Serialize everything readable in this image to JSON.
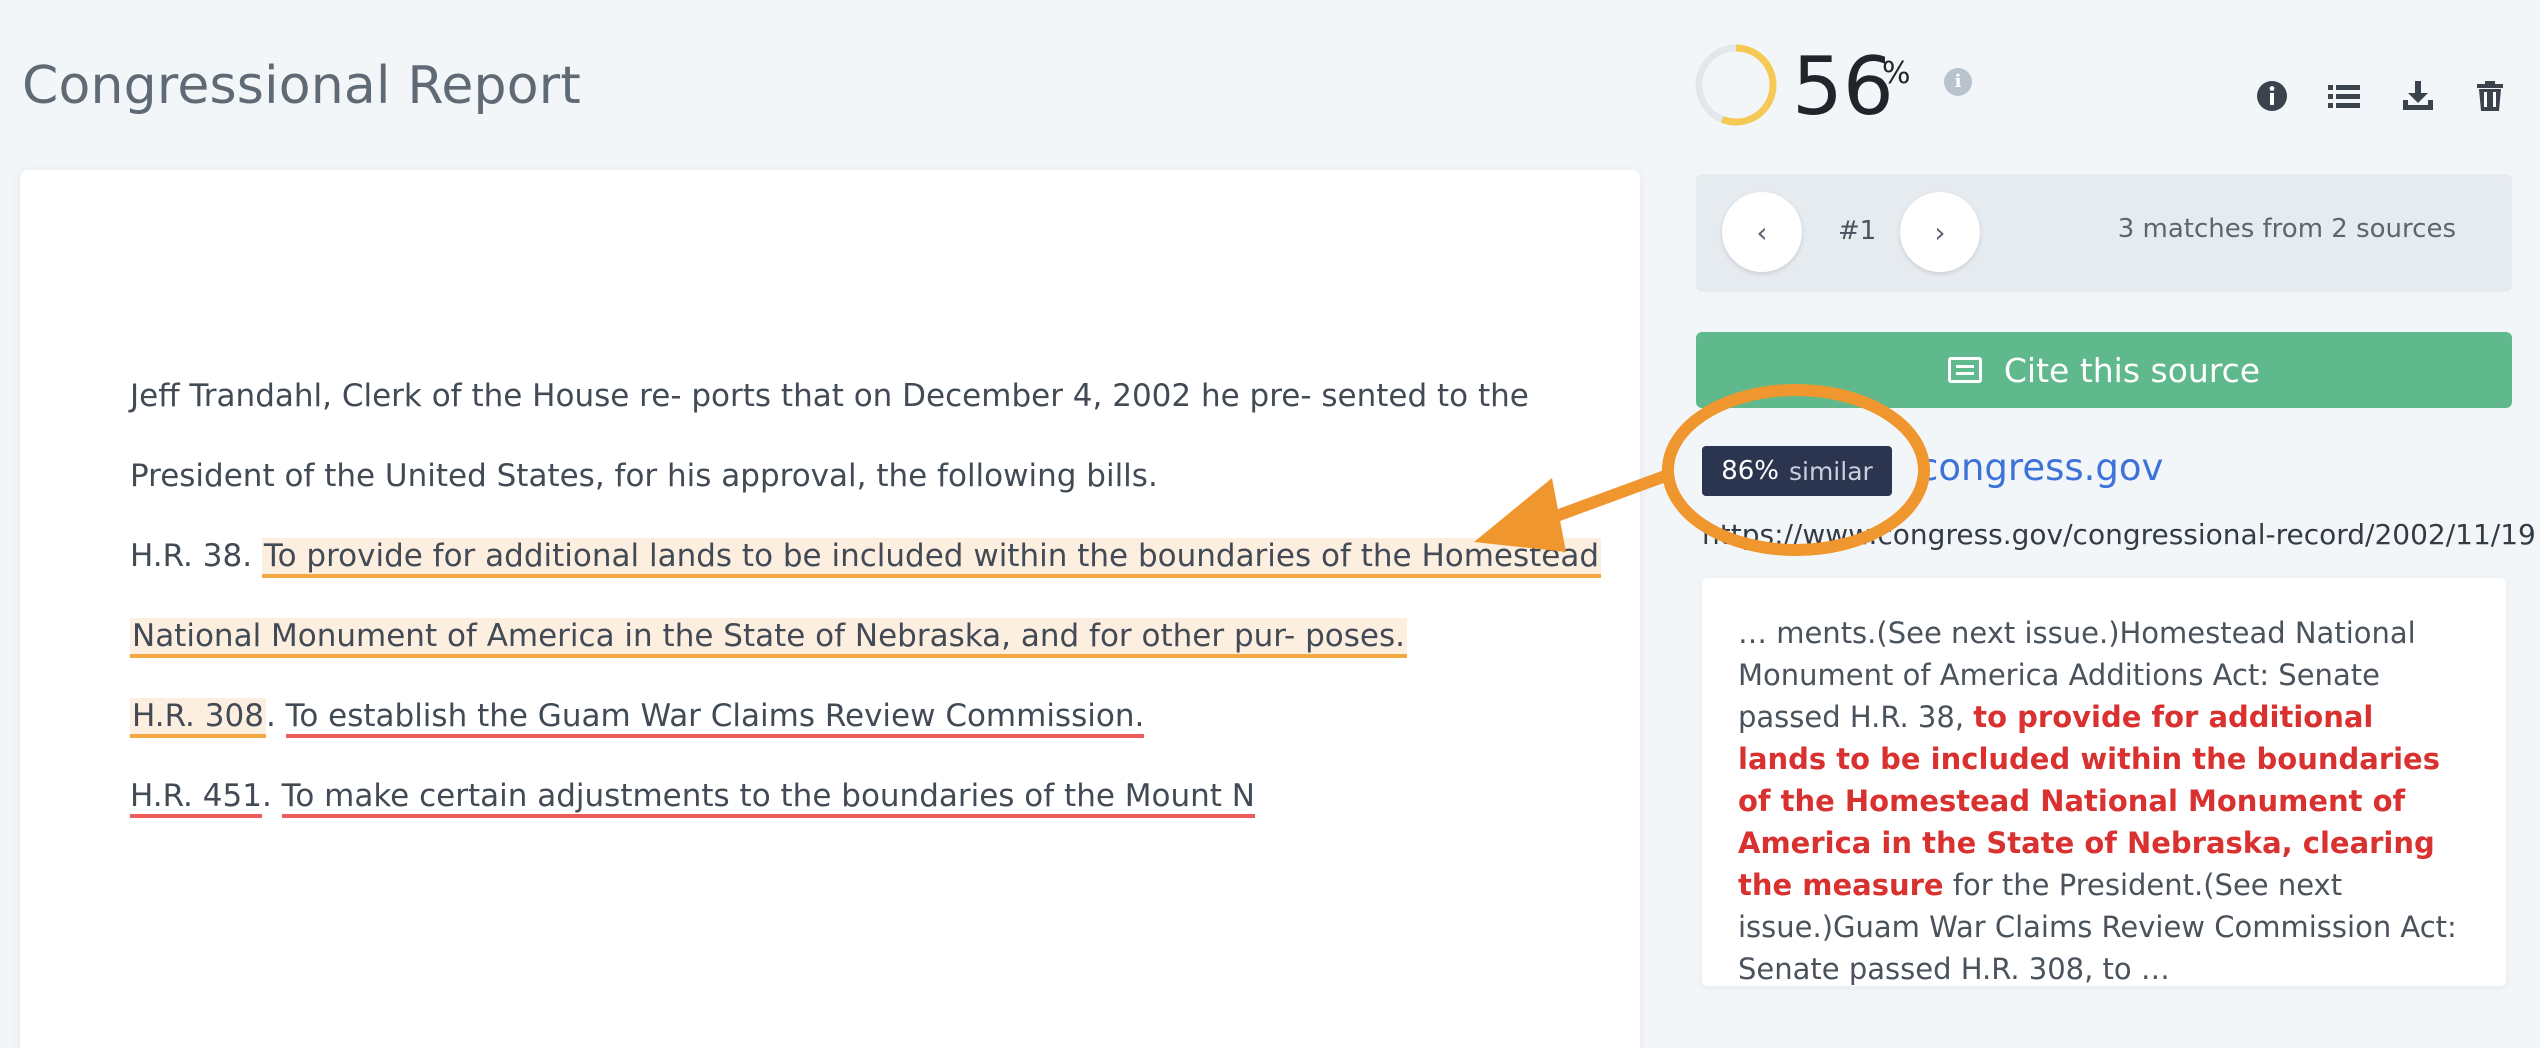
{
  "page": {
    "title": "Congressional Report"
  },
  "document": {
    "line1": "Jeff Trandahl, Clerk of the House re- ports that on December 4, 2002 he pre- sented to the",
    "line2": "President of the United States, for his approval, the following bills.",
    "line3_prefix": "H.R. 38. ",
    "line3_highlight": "To provide for additional lands to be included within the boundaries of the Homestead",
    "line4_highlight": "National Monument of America in the State of Nebraska, and for other pur- poses.",
    "line5_bill": "H.R. 308",
    "line5_dot": ". ",
    "line5_text": "To establish the Guam War Claims Review Commission.",
    "line6_bill": "H.R. 451",
    "line6_dot": ". ",
    "line6_text": "To make certain adjustments to the boundaries of the Mount N"
  },
  "score": {
    "value": "56",
    "unit": "%",
    "percent": 56,
    "info": "i"
  },
  "toolbar": {
    "icons": [
      "info-icon",
      "list-icon",
      "download-icon",
      "trash-icon"
    ]
  },
  "nav": {
    "prev": "‹",
    "next": "›",
    "index": "#1",
    "matches": "3 matches from 2 sources"
  },
  "cite": {
    "label": "Cite this source"
  },
  "source": {
    "similarity_value": "86%",
    "similarity_label": "similar",
    "domain": "congress.gov",
    "url": "https://www.congress.gov/congressional-record/2002/11/19"
  },
  "excerpt": {
    "before": "… ments.(See next issue.)Homestead National Monument of America Additions Act: Senate passed H.R. 38, ",
    "match": "to provide for additional lands to be included within the boundaries of the Homestead National Monument of America in the State of Nebraska, clearing the measure",
    "after": " for the President.(See next issue.)Guam War Claims Review Commission Act: Senate passed H.R. 308, to …"
  },
  "colors": {
    "accent_green": "#5fb98c",
    "highlight_orange": "#f2a83e",
    "match_red": "#d8312f",
    "annotation_orange": "#f0962e",
    "score_ring": "#f6c955"
  }
}
